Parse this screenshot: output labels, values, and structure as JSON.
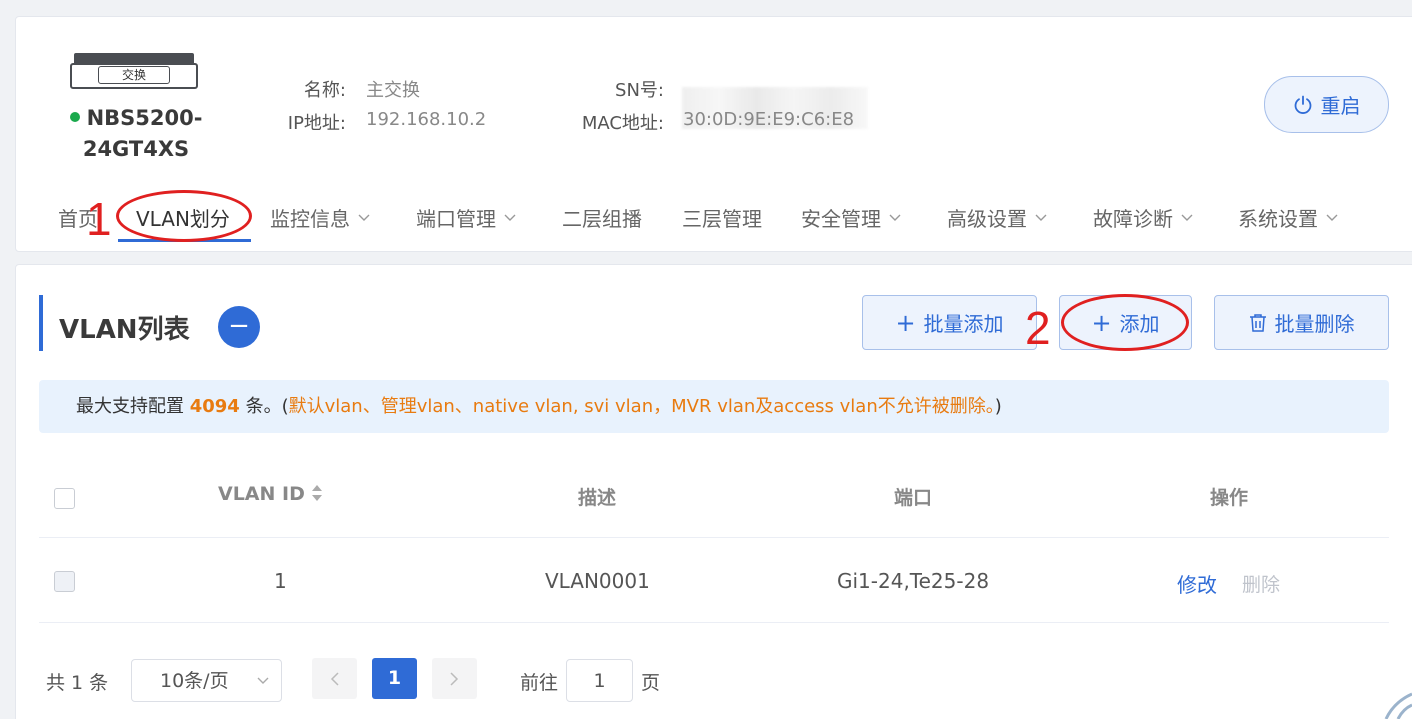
{
  "device": {
    "image_label": "交换",
    "model": "NBS5200-24GT4XS",
    "model_line1": "NBS5200-",
    "model_line2": "24GT4XS",
    "status_color": "#1aa94c",
    "name_label": "名称:",
    "name_value": "主交换",
    "ip_label": "IP地址:",
    "ip_value": "192.168.10.2",
    "sn_label": "SN号:",
    "sn_value": "",
    "mac_label": "MAC地址:",
    "mac_value": "30:0D:9E:E9:C6:E8"
  },
  "reboot_button": {
    "label": "重启",
    "icon": "power-icon"
  },
  "nav": {
    "items": [
      {
        "label": "首页",
        "has_dropdown": false
      },
      {
        "label": "VLAN划分",
        "has_dropdown": false,
        "active": true
      },
      {
        "label": "监控信息",
        "has_dropdown": true
      },
      {
        "label": "端口管理",
        "has_dropdown": true
      },
      {
        "label": "二层组播",
        "has_dropdown": false
      },
      {
        "label": "三层管理",
        "has_dropdown": false
      },
      {
        "label": "安全管理",
        "has_dropdown": true
      },
      {
        "label": "高级设置",
        "has_dropdown": true
      },
      {
        "label": "故障诊断",
        "has_dropdown": true
      },
      {
        "label": "系统设置",
        "has_dropdown": true
      }
    ]
  },
  "vlan_section": {
    "title": "VLAN列表",
    "collapse_symbol": "−",
    "buttons": {
      "batch_add": "批量添加",
      "add": "添加",
      "batch_delete": "批量删除"
    },
    "tip": {
      "prefix": "最大支持配置",
      "max": "4094",
      "suffix": "条。(",
      "warning": "默认vlan、管理vlan、native vlan, svi vlan，MVR vlan及access vlan不允许被删除。",
      "close": ")"
    },
    "table": {
      "columns": [
        "VLAN ID",
        "描述",
        "端口",
        "操作"
      ],
      "rows": [
        {
          "vlan_id": "1",
          "description": "VLAN0001",
          "ports": "Gi1-24,Te25-28",
          "edit": "修改",
          "delete": "删除"
        }
      ]
    },
    "pagination": {
      "total": "共 1 条",
      "page_size": "10条/页",
      "current_page": "1",
      "goto_label": "前往",
      "goto_value": "1",
      "goto_suffix": "页"
    }
  },
  "annotations": {
    "step1": "1",
    "step2": "2",
    "color": "#e02020"
  },
  "colors": {
    "accent": "#2f6bd6",
    "warning": "#e87b10",
    "tip_bg": "#e8f2fd"
  }
}
